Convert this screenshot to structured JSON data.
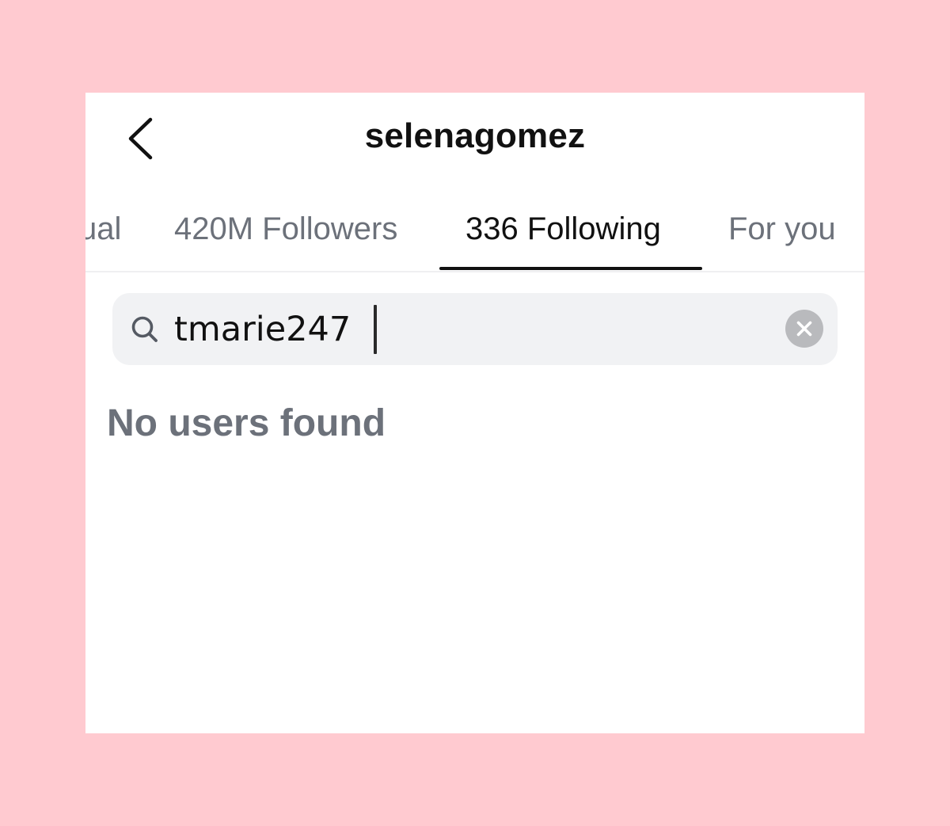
{
  "header": {
    "title": "selenagomez",
    "back_icon": "chevron-left-icon"
  },
  "tabs": [
    {
      "label": "ual",
      "active": false
    },
    {
      "label": "420M Followers",
      "active": false
    },
    {
      "label": "336 Following",
      "active": true
    },
    {
      "label": "For you",
      "active": false
    }
  ],
  "search": {
    "icon": "search-icon",
    "value": "tmarie247",
    "placeholder": "",
    "clear_icon": "clear-x-icon"
  },
  "results": {
    "empty_message": "No users found"
  },
  "colors": {
    "page_background": "#ffcad0",
    "card_background": "#ffffff",
    "active_text": "#111111",
    "inactive_text": "#6c717a",
    "search_background": "#f1f2f4"
  }
}
